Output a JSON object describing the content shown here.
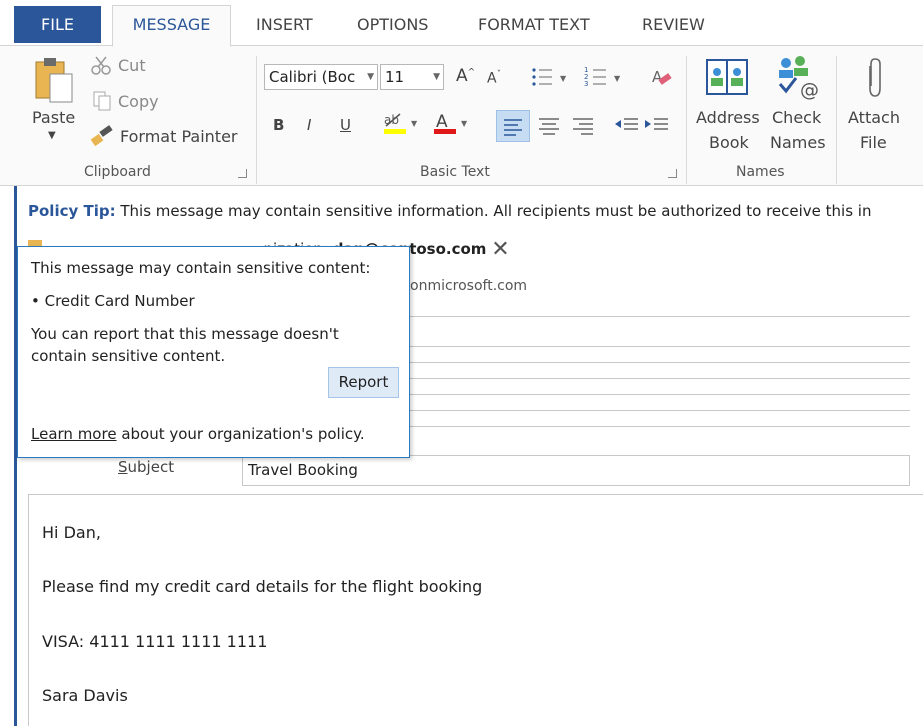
{
  "tabs": [
    {
      "label": "FILE"
    },
    {
      "label": "MESSAGE"
    },
    {
      "label": "INSERT"
    },
    {
      "label": "OPTIONS"
    },
    {
      "label": "FORMAT TEXT"
    },
    {
      "label": "REVIEW"
    }
  ],
  "clipboard": {
    "paste": "Paste",
    "cut": "Cut",
    "copy": "Copy",
    "format_painter": "Format Painter",
    "group": "Clipboard"
  },
  "basic_text": {
    "font_name": "Calibri (Boc",
    "font_size": "11",
    "bold": "B",
    "italic": "I",
    "underline": "U",
    "group": "Basic Text"
  },
  "names": {
    "address_book_1": "Address",
    "address_book_2": "Book",
    "check_names_1": "Check",
    "check_names_2": "Names",
    "group": "Names"
  },
  "include": {
    "attach_1": "Attach",
    "attach_2": "File"
  },
  "policy_tip": {
    "label": "Policy Tip:",
    "text": "This message may contain sensitive information. All recipients must be authorized to receive this in"
  },
  "recipient_warning": {
    "text_hidden": "The following recipient is outside your organization:",
    "email": "dan@contoso.com",
    "fragment": "onmicrosoft.com",
    "visible_tail": "nization:"
  },
  "popup": {
    "line1": "This message may contain sensitive content:",
    "line2": "• Credit Card Number",
    "line3": "You can report that this message doesn't",
    "line4": "contain sensitive content.",
    "report": "Report",
    "learn_more": "Learn more",
    "learn_more_tail": "about your organization's policy."
  },
  "subject": {
    "label": "Subject",
    "value": "Travel Booking"
  },
  "body": {
    "greeting": "Hi Dan,",
    "line1": "Please find my credit card details for the flight booking",
    "line2": "VISA: 4111 1111 1111 1111",
    "signature": "Sara Davis"
  },
  "colors": {
    "accent": "#2b579a",
    "popup_border": "#2b79c2",
    "button_fill": "#dfeaf7"
  }
}
